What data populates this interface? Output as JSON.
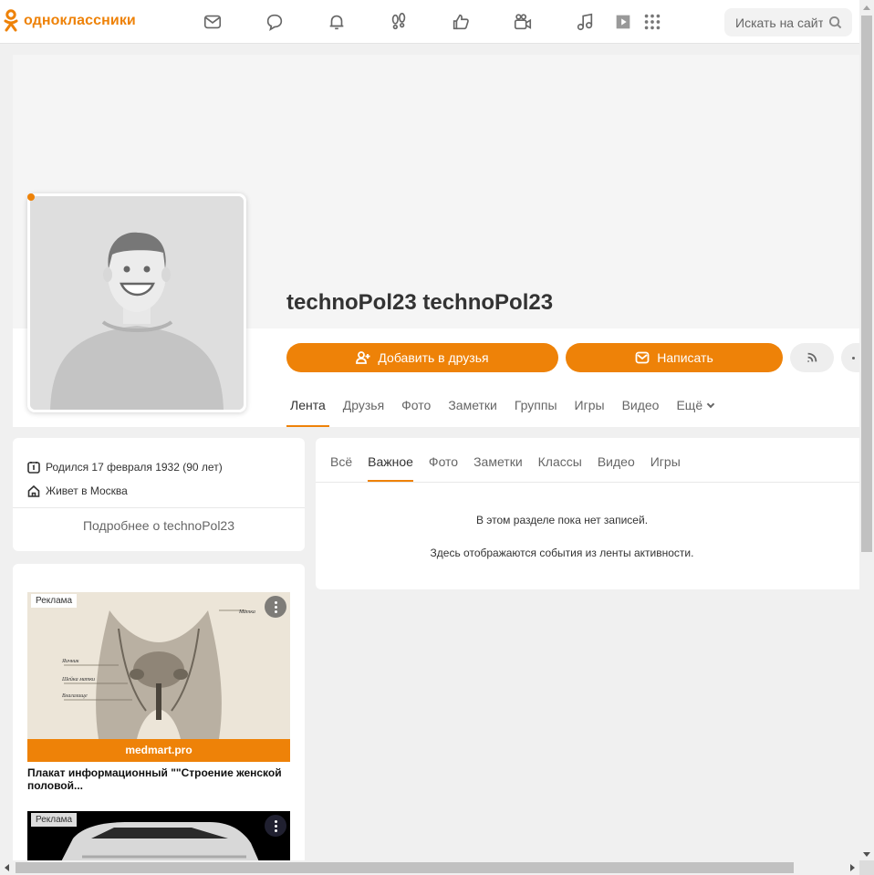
{
  "header": {
    "logo_text": "одноклассники",
    "brand_color": "#ee8208",
    "nav_icons": [
      "messages-icon",
      "discussions-icon",
      "notifications-icon",
      "guests-icon",
      "events-icon",
      "friends-video-icon",
      "music-icon",
      "video-icon",
      "apps-grid-icon"
    ],
    "search_placeholder": "Искать на сайте"
  },
  "profile": {
    "name": "technoPol23 technoPol23",
    "add_friend_label": "Добавить в друзья",
    "write_label": "Написать",
    "tabs": [
      "Лента",
      "Друзья",
      "Фото",
      "Заметки",
      "Группы",
      "Игры",
      "Видео",
      "Ещё"
    ],
    "active_tab": "Лента"
  },
  "info": {
    "birth": "Родился 17 февраля 1932 (90 лет)",
    "location": "Живет в Москва",
    "more_label": "Подробнее о technoPol23"
  },
  "ads": [
    {
      "label": "Реклама",
      "domain": "medmart.pro",
      "title": "Плакат информационный \"\"Строение женской половой..."
    },
    {
      "label": "Реклама"
    }
  ],
  "feed": {
    "tabs": [
      "Всё",
      "Важное",
      "Фото",
      "Заметки",
      "Классы",
      "Видео",
      "Игры"
    ],
    "active_tab": "Важное",
    "empty_title": "В этом разделе пока нет записей.",
    "empty_subtitle": "Здесь отображаются события из ленты активности."
  }
}
